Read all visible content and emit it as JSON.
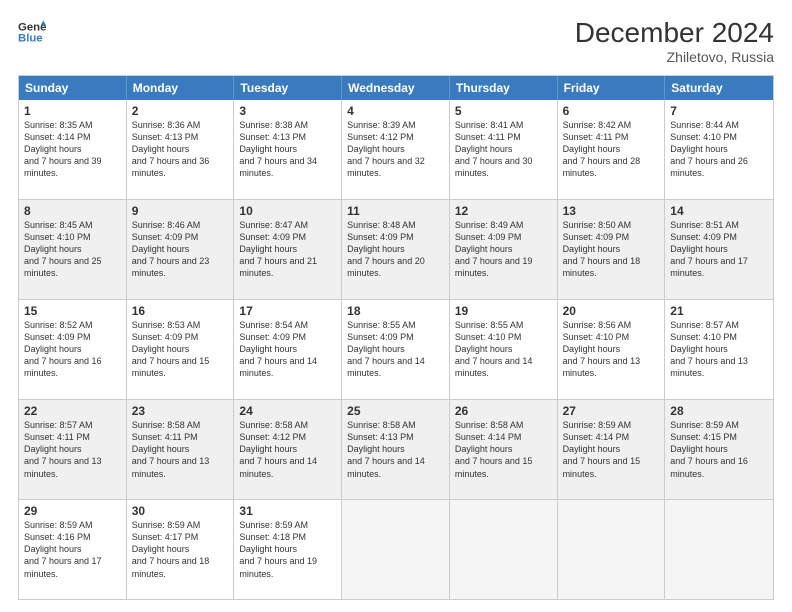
{
  "header": {
    "logo_line1": "General",
    "logo_line2": "Blue",
    "title": "December 2024",
    "subtitle": "Zhiletovo, Russia"
  },
  "days": [
    "Sunday",
    "Monday",
    "Tuesday",
    "Wednesday",
    "Thursday",
    "Friday",
    "Saturday"
  ],
  "rows": [
    [
      {
        "day": 1,
        "sr": "8:35 AM",
        "ss": "4:14 PM",
        "dl": "7 hours and 39 minutes.",
        "shaded": false
      },
      {
        "day": 2,
        "sr": "8:36 AM",
        "ss": "4:13 PM",
        "dl": "7 hours and 36 minutes.",
        "shaded": false
      },
      {
        "day": 3,
        "sr": "8:38 AM",
        "ss": "4:13 PM",
        "dl": "7 hours and 34 minutes.",
        "shaded": false
      },
      {
        "day": 4,
        "sr": "8:39 AM",
        "ss": "4:12 PM",
        "dl": "7 hours and 32 minutes.",
        "shaded": false
      },
      {
        "day": 5,
        "sr": "8:41 AM",
        "ss": "4:11 PM",
        "dl": "7 hours and 30 minutes.",
        "shaded": false
      },
      {
        "day": 6,
        "sr": "8:42 AM",
        "ss": "4:11 PM",
        "dl": "7 hours and 28 minutes.",
        "shaded": false
      },
      {
        "day": 7,
        "sr": "8:44 AM",
        "ss": "4:10 PM",
        "dl": "7 hours and 26 minutes.",
        "shaded": false
      }
    ],
    [
      {
        "day": 8,
        "sr": "8:45 AM",
        "ss": "4:10 PM",
        "dl": "7 hours and 25 minutes.",
        "shaded": true
      },
      {
        "day": 9,
        "sr": "8:46 AM",
        "ss": "4:09 PM",
        "dl": "7 hours and 23 minutes.",
        "shaded": true
      },
      {
        "day": 10,
        "sr": "8:47 AM",
        "ss": "4:09 PM",
        "dl": "7 hours and 21 minutes.",
        "shaded": true
      },
      {
        "day": 11,
        "sr": "8:48 AM",
        "ss": "4:09 PM",
        "dl": "7 hours and 20 minutes.",
        "shaded": true
      },
      {
        "day": 12,
        "sr": "8:49 AM",
        "ss": "4:09 PM",
        "dl": "7 hours and 19 minutes.",
        "shaded": true
      },
      {
        "day": 13,
        "sr": "8:50 AM",
        "ss": "4:09 PM",
        "dl": "7 hours and 18 minutes.",
        "shaded": true
      },
      {
        "day": 14,
        "sr": "8:51 AM",
        "ss": "4:09 PM",
        "dl": "7 hours and 17 minutes.",
        "shaded": true
      }
    ],
    [
      {
        "day": 15,
        "sr": "8:52 AM",
        "ss": "4:09 PM",
        "dl": "7 hours and 16 minutes.",
        "shaded": false
      },
      {
        "day": 16,
        "sr": "8:53 AM",
        "ss": "4:09 PM",
        "dl": "7 hours and 15 minutes.",
        "shaded": false
      },
      {
        "day": 17,
        "sr": "8:54 AM",
        "ss": "4:09 PM",
        "dl": "7 hours and 14 minutes.",
        "shaded": false
      },
      {
        "day": 18,
        "sr": "8:55 AM",
        "ss": "4:09 PM",
        "dl": "7 hours and 14 minutes.",
        "shaded": false
      },
      {
        "day": 19,
        "sr": "8:55 AM",
        "ss": "4:10 PM",
        "dl": "7 hours and 14 minutes.",
        "shaded": false
      },
      {
        "day": 20,
        "sr": "8:56 AM",
        "ss": "4:10 PM",
        "dl": "7 hours and 13 minutes.",
        "shaded": false
      },
      {
        "day": 21,
        "sr": "8:57 AM",
        "ss": "4:10 PM",
        "dl": "7 hours and 13 minutes.",
        "shaded": false
      }
    ],
    [
      {
        "day": 22,
        "sr": "8:57 AM",
        "ss": "4:11 PM",
        "dl": "7 hours and 13 minutes.",
        "shaded": true
      },
      {
        "day": 23,
        "sr": "8:58 AM",
        "ss": "4:11 PM",
        "dl": "7 hours and 13 minutes.",
        "shaded": true
      },
      {
        "day": 24,
        "sr": "8:58 AM",
        "ss": "4:12 PM",
        "dl": "7 hours and 14 minutes.",
        "shaded": true
      },
      {
        "day": 25,
        "sr": "8:58 AM",
        "ss": "4:13 PM",
        "dl": "7 hours and 14 minutes.",
        "shaded": true
      },
      {
        "day": 26,
        "sr": "8:58 AM",
        "ss": "4:14 PM",
        "dl": "7 hours and 15 minutes.",
        "shaded": true
      },
      {
        "day": 27,
        "sr": "8:59 AM",
        "ss": "4:14 PM",
        "dl": "7 hours and 15 minutes.",
        "shaded": true
      },
      {
        "day": 28,
        "sr": "8:59 AM",
        "ss": "4:15 PM",
        "dl": "7 hours and 16 minutes.",
        "shaded": true
      }
    ],
    [
      {
        "day": 29,
        "sr": "8:59 AM",
        "ss": "4:16 PM",
        "dl": "7 hours and 17 minutes.",
        "shaded": false
      },
      {
        "day": 30,
        "sr": "8:59 AM",
        "ss": "4:17 PM",
        "dl": "7 hours and 18 minutes.",
        "shaded": false
      },
      {
        "day": 31,
        "sr": "8:59 AM",
        "ss": "4:18 PM",
        "dl": "7 hours and 19 minutes.",
        "shaded": false
      },
      null,
      null,
      null,
      null
    ]
  ]
}
